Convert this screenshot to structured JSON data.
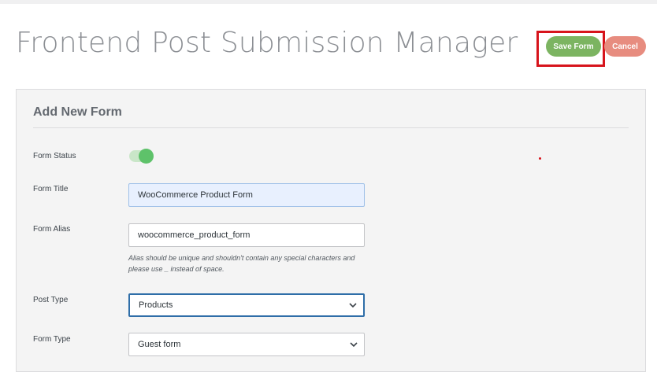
{
  "header": {
    "title": "Frontend Post Submission Manager",
    "save_label": "Save Form",
    "cancel_label": "Cancel"
  },
  "panel": {
    "title": "Add New Form"
  },
  "form": {
    "status": {
      "label": "Form Status",
      "enabled": true
    },
    "title": {
      "label": "Form Title",
      "value": "WooCommerce Product Form"
    },
    "alias": {
      "label": "Form Alias",
      "value": "woocommerce_product_form",
      "hint_line1": "Alias should be unique and shouldn't contain any special characters and",
      "hint_line2": "please use _ instead of space."
    },
    "post_type": {
      "label": "Post Type",
      "selected": "Products"
    },
    "form_type": {
      "label": "Form Type",
      "selected": "Guest form"
    }
  },
  "colors": {
    "save": "#7cb461",
    "cancel": "#e78c7f",
    "highlight": "#d7141c",
    "toggle_on": "#5ec26a"
  }
}
